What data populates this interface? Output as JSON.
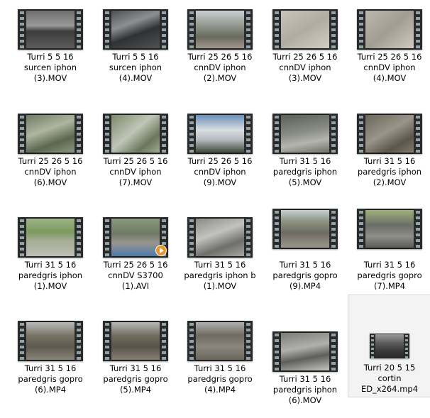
{
  "files": [
    {
      "lines": [
        "Turri 5 5 16",
        "surcen iphon",
        "(3).MOV"
      ],
      "scene": "linear-gradient(180deg,#6f6f6f 0%,#9a9a9a 40%,#3b3b3b 55%,#5d5d5d 100%)"
    },
    {
      "lines": [
        "Turri 5 5 16",
        "surcen iphon",
        "(4).MOV"
      ],
      "scene": "linear-gradient(160deg,#4d5050 0%,#8d9090 35%,#2f3232 60%,#4f5252 100%)"
    },
    {
      "lines": [
        "Turri 25 26 5 16",
        "cnnDV iphon",
        "(2).MOV"
      ],
      "scene": "linear-gradient(180deg,#c9cfd3 0%,#8b8f86 45%,#6a6a5e 70%,#a09a8c 100%)"
    },
    {
      "lines": [
        "Turri 25 26 5 16",
        "cnnDV iphon",
        "(3).MOV"
      ],
      "scene": "linear-gradient(150deg,#c8c4ba 0%,#b0aca2 50%,#d2cec4 100%)"
    },
    {
      "lines": [
        "Turri 25 26 5 16",
        "cnnDV iphon",
        "(4).MOV"
      ],
      "scene": "linear-gradient(140deg,#bdb8ad 0%,#a29d92 50%,#cfcac0 100%)"
    },
    {
      "lines": [
        "Turri 25 26 5 16",
        "cnnDV iphon",
        "(6).MOV"
      ],
      "scene": "linear-gradient(160deg,#6f7a62 0%,#aeb6a2 40%,#5c6650 70%,#8e967c 100%)"
    },
    {
      "lines": [
        "Turri 25 26 5 16",
        "cnnDV iphon",
        "(7).MOV"
      ],
      "scene": "linear-gradient(140deg,#7c8a6a 0%,#c0c6b8 45%,#69775a 75%,#a3ab96 100%)"
    },
    {
      "lines": [
        "Turri 25 26 5 16",
        "cnnDV iphon",
        "(9).MOV"
      ],
      "scene": "linear-gradient(180deg,#6a8fb8 0%,#d8dde2 40%,#b8bcc0 65%,#3e4a3a 100%)"
    },
    {
      "lines": [
        "Turri 31 5 16",
        "paredgris iphon",
        "(5).MOV"
      ],
      "scene": "linear-gradient(170deg,#5c5f58 0%,#8a8d85 45%,#b4b6ae 70%,#6e6f68 100%)"
    },
    {
      "lines": [
        "Turri 31 5 16",
        "paredgris iphon",
        "(2).MOV"
      ],
      "scene": "linear-gradient(150deg,#6a6658 0%,#9a958a 45%,#5a5649 75%,#7e7a6c 100%)"
    },
    {
      "lines": [
        "Turri 31 5 16",
        "paredgris iphon",
        "(1).MOV"
      ],
      "scene": "linear-gradient(180deg,#9fb38a 0%,#7c9a5e 35%,#a8ad98 60%,#bcbfb2 100%)"
    },
    {
      "lines": [
        "Turri 25 26 5 16",
        "cnnDV S3700",
        "(1).AVI"
      ],
      "scene": "linear-gradient(180deg,#8a9a7c 0%,#6f7a66 40%,#9a9690 65%,#4a7aa8 100%)",
      "play": true
    },
    {
      "lines": [
        "Turri 31 5 16",
        "paredgris iphon b",
        "(1).MOV"
      ],
      "scene": "linear-gradient(160deg,#8a8a86 0%,#c2c2be 40%,#6e6e6a 70%,#a6a6a2 100%)"
    },
    {
      "lines": [
        "Turri 31 5 16",
        "paredgris gopro",
        "(9).MP4"
      ],
      "scene": "linear-gradient(180deg,#c6cfd4 0%,#8c9380 30%,#6e6b62 60%,#9a968c 100%)"
    },
    {
      "lines": [
        "Turri 31 5 16",
        "paredgris gopro",
        "(7).MP4"
      ],
      "scene": "linear-gradient(180deg,#9fb07e 0%,#6b6e66 40%,#8e8e8a 70%,#5a5c58 100%)"
    },
    {
      "lines": [
        "Turri 31 5 16",
        "paredgris gopro",
        "(6).MP4"
      ],
      "scene": "linear-gradient(180deg,#b8bcbc 0%,#7a7466 35%,#5e5a50 65%,#8a8578 100%)"
    },
    {
      "lines": [
        "Turri 31 5 16",
        "paredgris gopro",
        "(5).MP4"
      ],
      "scene": "linear-gradient(180deg,#b6baba 0%,#736d60 35%,#58544a 65%,#857f72 100%)"
    },
    {
      "lines": [
        "Turri 31 5 16",
        "paredgris gopro",
        "(4).MP4"
      ],
      "scene": "linear-gradient(180deg,#aeb2b2 0%,#6f6a5f 35%,#8a877e 65%,#6a665c 100%)"
    },
    {
      "lines": [
        "Turri 31 5 16",
        "paredgris iphon",
        "(6).MOV"
      ],
      "scene": "linear-gradient(170deg,#7a7a76 0%,#b0b0ac 40%,#5e5e5a 65%,#c4c4c0 100%)"
    },
    {
      "lines": [
        "Turri 20 5 15",
        "cortin",
        "ED_x264.mp4"
      ],
      "scene": "linear-gradient(180deg,#9a9a9a 0%,#5a5a5a 40%,#3a3a3a 70%,#2a2a2a 100%)",
      "small": true,
      "selected": true
    }
  ]
}
